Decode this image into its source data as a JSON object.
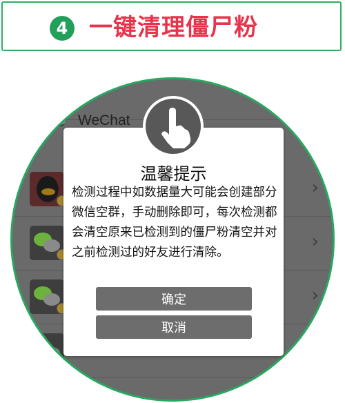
{
  "banner": {
    "step_number": "4",
    "title": "一键清理僵尸粉"
  },
  "background_list": {
    "rows": [
      {
        "label": "WeChat"
      },
      {
        "label": ""
      },
      {
        "label": ""
      },
      {
        "label": ""
      },
      {
        "label": ""
      }
    ]
  },
  "dialog": {
    "title": "温馨提示",
    "message": "检测过程中如数据量大可能会创建部分微信空群，手动删除即可，每次检测都会清空原来已检测到的僵尸粉清空并对之前检测过的好友进行清除。",
    "confirm_label": "确定",
    "cancel_label": "取消",
    "icon": "hand-pointer-icon"
  },
  "colors": {
    "accent_green": "#2fae5f",
    "title_red": "#e8334b",
    "button_gray": "#6d6d6d"
  }
}
